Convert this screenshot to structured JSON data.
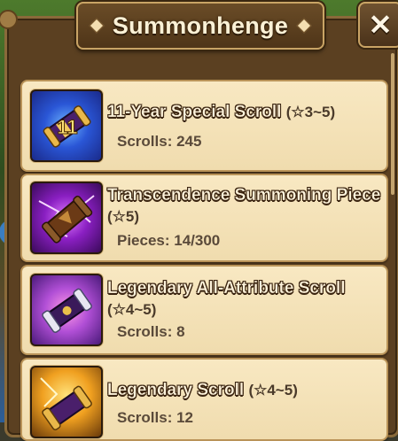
{
  "window": {
    "title": "Summonhenge",
    "close_label": "✕"
  },
  "items": [
    {
      "name": "11-Year Special Scroll",
      "rank": "(☆3~5)",
      "count_label": "Scrolls: 245",
      "icon": "special-scroll-icon"
    },
    {
      "name": "Transcendence Summoning Piece",
      "rank": "(☆5)",
      "count_label": "Pieces: 14/300",
      "icon": "transcendence-piece-icon"
    },
    {
      "name": "Legendary All-Attribute Scroll",
      "rank": "(☆4~5)",
      "count_label": "Scrolls: 8",
      "icon": "legendary-all-attribute-scroll-icon"
    },
    {
      "name": "Legendary Scroll",
      "rank": "(☆4~5)",
      "count_label": "Scrolls: 12",
      "icon": "legendary-scroll-icon"
    }
  ],
  "colors": {
    "card_bg": "#f4e2b6",
    "frame": "#5b4021",
    "title_text": "#fbf1d6"
  }
}
